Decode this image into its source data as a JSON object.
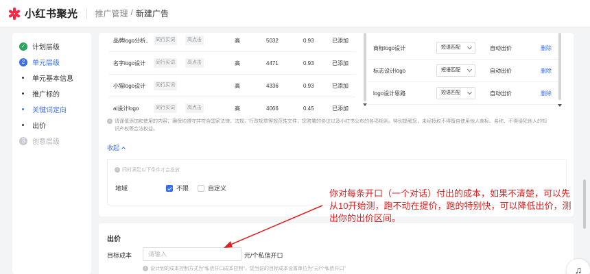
{
  "app": {
    "name": "小红书聚光"
  },
  "breadcrumb": {
    "parent": "推广管理",
    "sep": "/",
    "current": "新建广告"
  },
  "sidebar": {
    "steps": [
      {
        "label": "计划层级",
        "status": "done"
      },
      {
        "label": "单元层级",
        "status": "active",
        "num": "2"
      },
      {
        "label": "单元基本信息",
        "sub": true
      },
      {
        "label": "推广标的",
        "sub": true
      },
      {
        "label": "关键词定向",
        "sub": true,
        "active": true
      },
      {
        "label": "出价",
        "sub": true
      },
      {
        "label": "创意层级",
        "status": "todo",
        "num": "3"
      }
    ]
  },
  "keywords_left": {
    "rows": [
      {
        "kw": "品牌logo分析...",
        "tags": [
          "同行买词",
          "高点击"
        ],
        "comp": "高",
        "num": "5032",
        "price": "0.93",
        "status": "已添加"
      },
      {
        "kw": "名字logo设计",
        "tags": [
          "同行买词",
          "高点击"
        ],
        "comp": "高",
        "num": "4471",
        "price": "0.93",
        "status": "已添加"
      },
      {
        "kw": "小猫logo设计",
        "tags": [
          "同行买词"
        ],
        "comp": "高",
        "num": "4336",
        "price": "0.93",
        "status": "已添加"
      },
      {
        "kw": "ai设计logo",
        "tags": [
          "同行买词",
          "高点击"
        ],
        "comp": "高",
        "num": "4066",
        "price": "0.45",
        "status": "已添加"
      }
    ]
  },
  "keywords_right": {
    "rows": [
      {
        "kw": "商标logo设计",
        "match": "短语匹配",
        "bid": "自动出价",
        "del": "删除"
      },
      {
        "kw": "标志设计logo",
        "match": "短语匹配",
        "bid": "自动出价",
        "del": "删除"
      },
      {
        "kw": "logo设计思路",
        "match": "短语匹配",
        "bid": "自动出价",
        "del": "删除"
      }
    ]
  },
  "notice": {
    "line1": "请谨慎添加和使用的内容，确保均遵守并符合国家法律、法规、行政规章等规范性文件，您答署的协议以及小红书公布的各项规则。特别提醒您，未经授权不得擅自使用他人商标、名称、不得侵犯他人的知",
    "line2": "识产权等合法权益。"
  },
  "collapse": {
    "label": "收起"
  },
  "conditions": {
    "hint": "同时满足以下条件才会投放",
    "region_label": "地域",
    "option_unlimited": "不限",
    "option_custom": "自定义"
  },
  "annotation": {
    "text": "你对每条开口（一个对话）付出的成本，如果不清楚，可以先从10开始测，跑不动在提价，跑的特别快，可以降低出价，测出你的出价区间。",
    "color": "#e02020"
  },
  "bid_section": {
    "title": "出价",
    "target_label": "目标成本",
    "target_placeholder": "请输入",
    "unit": "元/个私信开口",
    "note": "设计划的成本控制方式为\"私信开口成本控制\"，您当前的目标成本设置单位为\"元/个私信开口\""
  },
  "help": {
    "icon": "headset-icon",
    "glyph": "♫"
  },
  "colors": {
    "brand": "#ff2442",
    "accent": "#3a6ee8",
    "done": "#26a65b"
  }
}
